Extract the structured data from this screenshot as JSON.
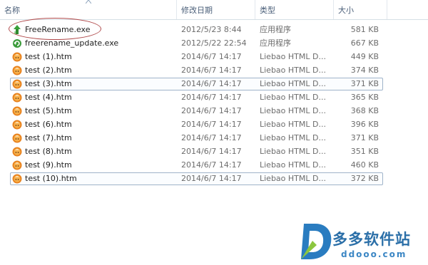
{
  "columns": {
    "name": "名称",
    "date": "修改日期",
    "type": "类型",
    "size": "大小"
  },
  "files": [
    {
      "name": "FreeRename.exe",
      "date": "2012/5/23 8:44",
      "type": "应用程序",
      "size": "581 KB",
      "icon": "freerename-app-icon"
    },
    {
      "name": "freerename_update.exe",
      "date": "2012/5/22 22:54",
      "type": "应用程序",
      "size": "667 KB",
      "icon": "update-app-icon"
    },
    {
      "name": "test (1).htm",
      "date": "2014/6/7 14:17",
      "type": "Liebao HTML D...",
      "size": "449 KB",
      "icon": "liebao-html-icon"
    },
    {
      "name": "test (2).htm",
      "date": "2014/6/7 14:17",
      "type": "Liebao HTML D...",
      "size": "374 KB",
      "icon": "liebao-html-icon"
    },
    {
      "name": "test (3).htm",
      "date": "2014/6/7 14:17",
      "type": "Liebao HTML D...",
      "size": "371 KB",
      "icon": "liebao-html-icon"
    },
    {
      "name": "test (4).htm",
      "date": "2014/6/7 14:17",
      "type": "Liebao HTML D...",
      "size": "365 KB",
      "icon": "liebao-html-icon"
    },
    {
      "name": "test (5).htm",
      "date": "2014/6/7 14:17",
      "type": "Liebao HTML D...",
      "size": "368 KB",
      "icon": "liebao-html-icon"
    },
    {
      "name": "test (6).htm",
      "date": "2014/6/7 14:17",
      "type": "Liebao HTML D...",
      "size": "396 KB",
      "icon": "liebao-html-icon"
    },
    {
      "name": "test (7).htm",
      "date": "2014/6/7 14:17",
      "type": "Liebao HTML D...",
      "size": "371 KB",
      "icon": "liebao-html-icon"
    },
    {
      "name": "test (8).htm",
      "date": "2014/6/7 14:17",
      "type": "Liebao HTML D...",
      "size": "351 KB",
      "icon": "liebao-html-icon"
    },
    {
      "name": "test (9).htm",
      "date": "2014/6/7 14:17",
      "type": "Liebao HTML D...",
      "size": "460 KB",
      "icon": "liebao-html-icon"
    },
    {
      "name": "test (10).htm",
      "date": "2014/6/7 14:17",
      "type": "Liebao HTML D...",
      "size": "372 KB",
      "icon": "liebao-html-icon"
    }
  ],
  "focused_rows": [
    "test (3).htm",
    "test (10).htm"
  ],
  "annotated_file": "FreeRename.exe",
  "watermark": {
    "title": "多多软件站",
    "url": "ddooo.com"
  },
  "colors": {
    "header_text": "#4c607a",
    "focus_border": "#9fb3c9",
    "annotation": "#b0494a",
    "liebao_orange": "#e8821e",
    "watermark_blue": "#2b6fa8"
  }
}
